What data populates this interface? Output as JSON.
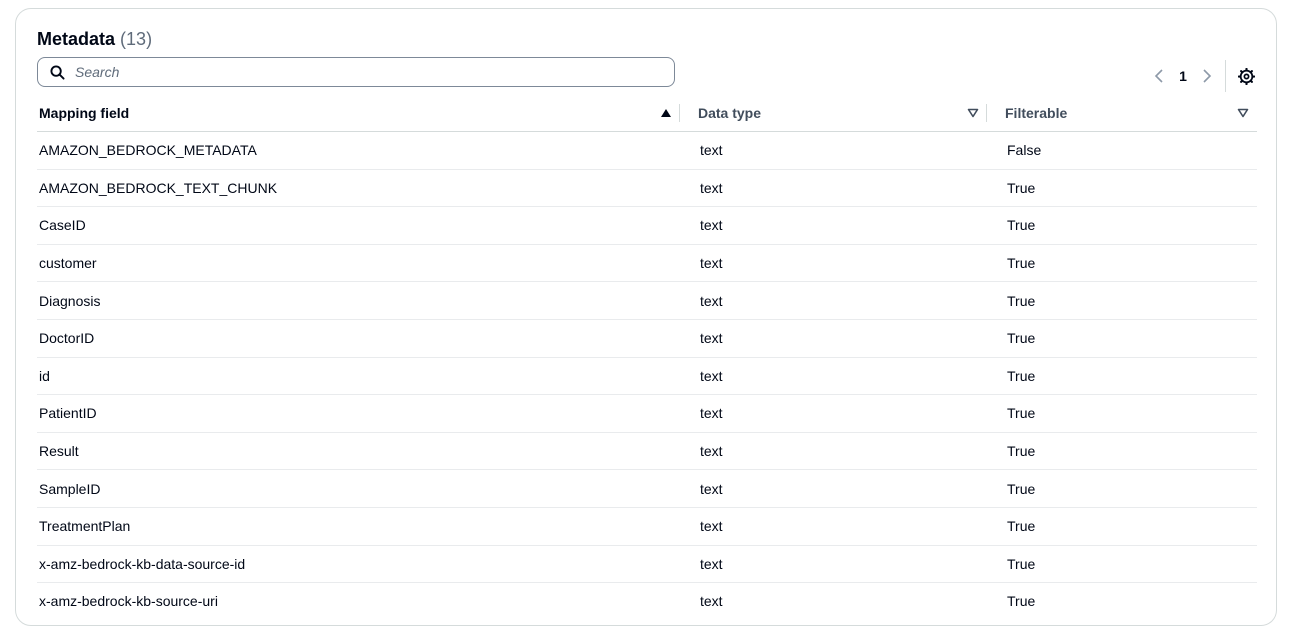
{
  "header": {
    "title": "Metadata",
    "count": "(13)"
  },
  "search": {
    "placeholder": "Search",
    "value": "",
    "icon": "search-icon"
  },
  "pagination": {
    "current_page": "1",
    "prev_icon": "chevron-left-icon",
    "next_icon": "chevron-right-icon",
    "settings_icon": "gear-icon"
  },
  "table": {
    "columns": [
      {
        "label": "Mapping field",
        "sort": "ascending"
      },
      {
        "label": "Data type",
        "sort": "none"
      },
      {
        "label": "Filterable",
        "sort": "none"
      }
    ],
    "rows": [
      {
        "field": "AMAZON_BEDROCK_METADATA",
        "type": "text",
        "filterable": "False"
      },
      {
        "field": "AMAZON_BEDROCK_TEXT_CHUNK",
        "type": "text",
        "filterable": "True"
      },
      {
        "field": "CaseID",
        "type": "text",
        "filterable": "True"
      },
      {
        "field": "customer",
        "type": "text",
        "filterable": "True"
      },
      {
        "field": "Diagnosis",
        "type": "text",
        "filterable": "True"
      },
      {
        "field": "DoctorID",
        "type": "text",
        "filterable": "True"
      },
      {
        "field": "id",
        "type": "text",
        "filterable": "True"
      },
      {
        "field": "PatientID",
        "type": "text",
        "filterable": "True"
      },
      {
        "field": "Result",
        "type": "text",
        "filterable": "True"
      },
      {
        "field": "SampleID",
        "type": "text",
        "filterable": "True"
      },
      {
        "field": "TreatmentPlan",
        "type": "text",
        "filterable": "True"
      },
      {
        "field": "x-amz-bedrock-kb-data-source-id",
        "type": "text",
        "filterable": "True"
      },
      {
        "field": "x-amz-bedrock-kb-source-uri",
        "type": "text",
        "filterable": "True"
      }
    ]
  }
}
